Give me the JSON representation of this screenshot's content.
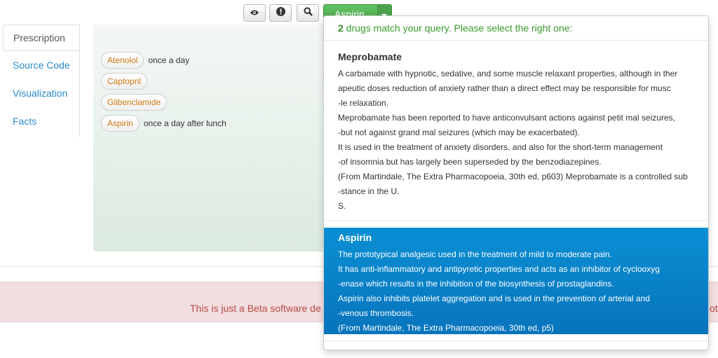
{
  "toolbar": {
    "buttons": [
      {
        "icon": "eye-icon"
      },
      {
        "icon": "exclamation-icon"
      },
      {
        "icon": "search-icon"
      }
    ],
    "drug_button_label": "Aspirin",
    "drug_button_color": "#5bb75b"
  },
  "tabs": [
    {
      "label": "Prescription",
      "active": true
    },
    {
      "label": "Source Code"
    },
    {
      "label": "Visualization"
    },
    {
      "label": "Facts"
    }
  ],
  "prescription": [
    {
      "drug": "Atenolol",
      "instruction": "once a day"
    },
    {
      "drug": "Captopril",
      "instruction": ""
    },
    {
      "drug": "Glibenclamide",
      "instruction": ""
    },
    {
      "drug": "Aspirin",
      "instruction": "once a day after lunch"
    }
  ],
  "beta_notice": "This is just a Beta software de",
  "beta_notice_tail": "ot",
  "dropdown": {
    "count": "2",
    "header_text": " drugs match your query. Please select the right one:",
    "items": [
      {
        "name": "Meprobamate",
        "selected": false,
        "lines": [
          "A carbamate with hypnotic, sedative, and some muscle relaxant properties, although in ther",
          "apeutic doses reduction of anxiety rather than a direct effect may be responsible for musc",
          "-le relaxation.",
          "Meprobamate has been reported to have anticonvulsant actions against petit mal seizures,",
          "-but not against grand mal seizures (which may be exacerbated).",
          "It is used in the treatment of anxiety disorders, and also for the short-term management",
          "-of insomnia but has largely been superseded by the benzodiazepines.",
          "(From Martindale, The Extra Pharmacopoeia, 30th ed, p603) Meprobamate is a controlled sub",
          "-stance in the U.",
          "S."
        ]
      },
      {
        "name": "Aspirin",
        "selected": true,
        "lines": [
          "The prototypical analgesic used in the treatment of mild to moderate pain.",
          "It has anti-inflammatory and antipyretic properties and acts as an inhibitor of cyclooxyg",
          "-enase which results in the inhibition of the biosynthesis of prostaglandins.",
          "Aspirin also inhibits platelet aggregation and is used in the prevention of arterial and",
          "-venous thrombosis.",
          "(From Martindale, The Extra Pharmacopoeia, 30th ed, p5)"
        ]
      }
    ]
  },
  "colors": {
    "accent_blue": "#0a8fd4",
    "pill_text": "#d07a12",
    "success_green": "#3a9a2c",
    "alert_bg": "#f2dede",
    "alert_text": "#b94a48"
  }
}
